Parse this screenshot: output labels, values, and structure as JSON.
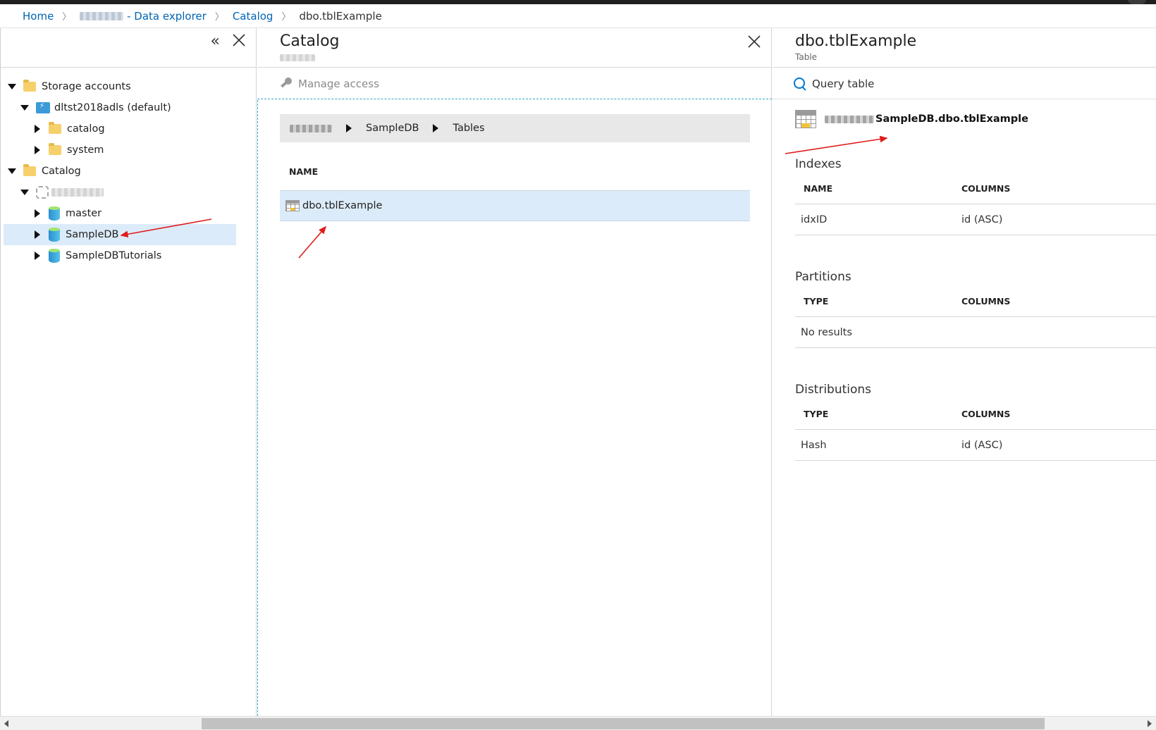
{
  "breadcrumb": {
    "home": "Home",
    "data_explorer": "- Data explorer",
    "catalog": "Catalog",
    "current": "dbo.tblExample"
  },
  "left_panel": {
    "collapse_glyph": "«",
    "tree": [
      {
        "label": "Storage accounts",
        "icon": "folder-icon",
        "level": 0,
        "expanded": true
      },
      {
        "label": "dltst2018adls (default)",
        "icon": "storage-icon",
        "level": 1,
        "expanded": true
      },
      {
        "label": "catalog",
        "icon": "folder-icon",
        "level": 2,
        "expanded": false
      },
      {
        "label": "system",
        "icon": "folder-icon",
        "level": 2,
        "expanded": false
      },
      {
        "label": "Catalog",
        "icon": "folder-icon",
        "level": 0,
        "expanded": true
      },
      {
        "label": "master",
        "icon": "database-icon",
        "level": 2,
        "expanded": false
      },
      {
        "label": "SampleDB",
        "icon": "database-icon",
        "level": 2,
        "expanded": false,
        "selected": true
      },
      {
        "label": "SampleDBTutorials",
        "icon": "database-icon",
        "level": 2,
        "expanded": false
      }
    ]
  },
  "middle_panel": {
    "title": "Catalog",
    "toolbar": {
      "manage_access": "Manage access"
    },
    "path": {
      "db": "SampleDB",
      "tables": "Tables"
    },
    "column_header": "NAME",
    "rows": [
      "dbo.tblExample"
    ]
  },
  "right_panel": {
    "title": "dbo.tblExample",
    "subtitle": "Table",
    "toolbar": {
      "query_table": "Query table"
    },
    "fqn": "SampleDB.dbo.tblExample",
    "indexes": {
      "title": "Indexes",
      "headers": [
        "NAME",
        "COLUMNS"
      ],
      "rows": [
        [
          "idxID",
          "id (ASC)"
        ]
      ]
    },
    "partitions": {
      "title": "Partitions",
      "headers": [
        "TYPE",
        "COLUMNS"
      ],
      "empty": "No results"
    },
    "distributions": {
      "title": "Distributions",
      "headers": [
        "TYPE",
        "COLUMNS"
      ],
      "rows": [
        [
          "Hash",
          "id (ASC)"
        ]
      ]
    }
  },
  "colors": {
    "link": "#0064b4",
    "selected": "#dcebf9",
    "accent": "#0078d4",
    "annotation_arrow": "#e01b1b"
  }
}
